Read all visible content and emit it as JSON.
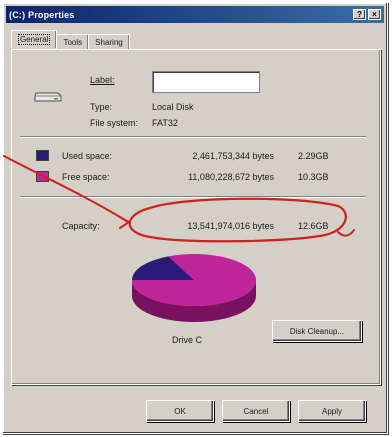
{
  "window": {
    "title": "(C:) Properties",
    "help_button": "?",
    "close_button": "×"
  },
  "tabs": [
    {
      "label": "General"
    },
    {
      "label": "Tools"
    },
    {
      "label": "Sharing"
    }
  ],
  "general": {
    "label_caption": "Label:",
    "label_value": "",
    "type_caption": "Type:",
    "type_value": "Local Disk",
    "filesystem_caption": "File system:",
    "filesystem_value": "FAT32",
    "used": {
      "caption": "Used space:",
      "bytes": "2,461,753,344 bytes",
      "size": "2.29GB",
      "color": "#2a1a7a"
    },
    "free": {
      "caption": "Free space:",
      "bytes": "11,080,228,672 bytes",
      "size": "10.3GB",
      "color": "#c0249a"
    },
    "capacity": {
      "caption": "Capacity:",
      "bytes": "13,541,974,016 bytes",
      "size": "12.6GB"
    },
    "used_fraction": 0.182,
    "drive_label": "Drive C",
    "disk_cleanup_button": "Disk Cleanup..."
  },
  "buttons": {
    "ok": "OK",
    "cancel": "Cancel",
    "apply": "Apply"
  },
  "annotation": {
    "color": "#d02020"
  }
}
